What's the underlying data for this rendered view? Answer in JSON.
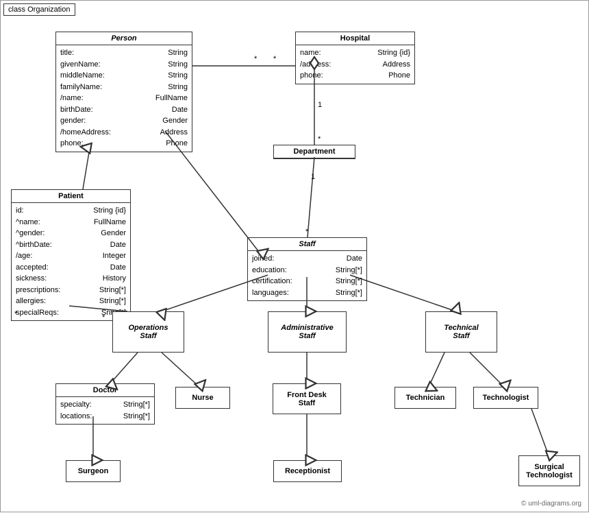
{
  "diagram": {
    "title": "class Organization",
    "copyright": "© uml-diagrams.org",
    "classes": {
      "person": {
        "name": "Person",
        "attrs": [
          [
            "title:",
            "String"
          ],
          [
            "givenName:",
            "String"
          ],
          [
            "middleName:",
            "String"
          ],
          [
            "familyName:",
            "String"
          ],
          [
            "/name:",
            "FullName"
          ],
          [
            "birthDate:",
            "Date"
          ],
          [
            "gender:",
            "Gender"
          ],
          [
            "/homeAddress:",
            "Address"
          ],
          [
            "phone:",
            "Phone"
          ]
        ]
      },
      "hospital": {
        "name": "Hospital",
        "attrs": [
          [
            "name:",
            "String {id}"
          ],
          [
            "/address:",
            "Address"
          ],
          [
            "phone:",
            "Phone"
          ]
        ]
      },
      "patient": {
        "name": "Patient",
        "attrs": [
          [
            "id:",
            "String {id}"
          ],
          [
            "^name:",
            "FullName"
          ],
          [
            "^gender:",
            "Gender"
          ],
          [
            "^birthDate:",
            "Date"
          ],
          [
            "/age:",
            "Integer"
          ],
          [
            "accepted:",
            "Date"
          ],
          [
            "sickness:",
            "History"
          ],
          [
            "prescriptions:",
            "String[*]"
          ],
          [
            "allergies:",
            "String[*]"
          ],
          [
            "specialReqs:",
            "Sring[*]"
          ]
        ]
      },
      "department": {
        "name": "Department"
      },
      "staff": {
        "name": "Staff",
        "attrs": [
          [
            "joined:",
            "Date"
          ],
          [
            "education:",
            "String[*]"
          ],
          [
            "certification:",
            "String[*]"
          ],
          [
            "languages:",
            "String[*]"
          ]
        ]
      },
      "operations_staff": {
        "name": "Operations\nStaff"
      },
      "administrative_staff": {
        "name": "Administrative\nStaff"
      },
      "technical_staff": {
        "name": "Technical\nStaff"
      },
      "doctor": {
        "name": "Doctor",
        "attrs": [
          [
            "specialty:",
            "String[*]"
          ],
          [
            "locations:",
            "String[*]"
          ]
        ]
      },
      "nurse": {
        "name": "Nurse"
      },
      "front_desk_staff": {
        "name": "Front Desk\nStaff"
      },
      "technician": {
        "name": "Technician"
      },
      "technologist": {
        "name": "Technologist"
      },
      "surgeon": {
        "name": "Surgeon"
      },
      "receptionist": {
        "name": "Receptionist"
      },
      "surgical_technologist": {
        "name": "Surgical\nTechnologist"
      }
    }
  }
}
